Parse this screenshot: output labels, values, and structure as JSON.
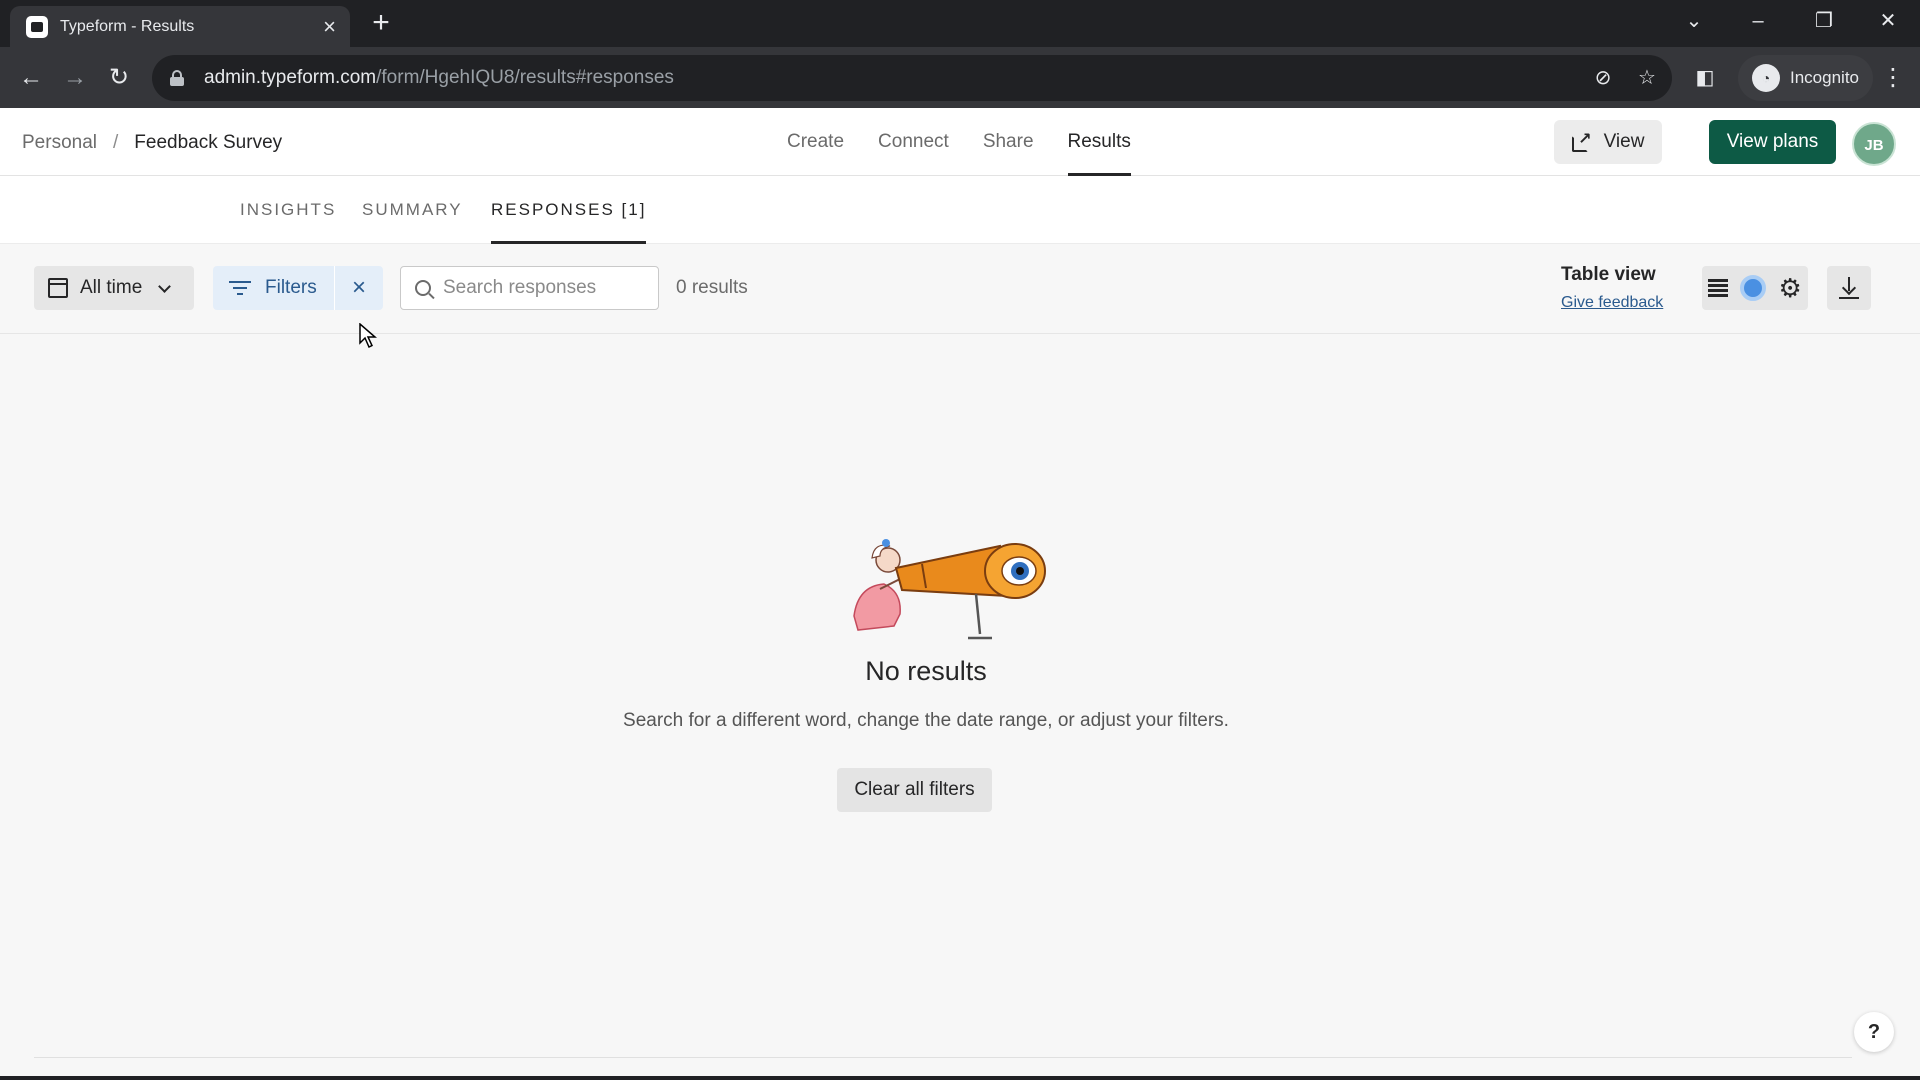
{
  "browser": {
    "tab_title": "Typeform - Results",
    "url_host": "admin.typeform.com",
    "url_path": "/form/HgehIQU8/results#responses",
    "profile_label": "Incognito"
  },
  "header": {
    "breadcrumb": [
      "Personal",
      "/",
      "Feedback Survey"
    ],
    "nav": [
      "Create",
      "Connect",
      "Share",
      "Results"
    ],
    "active_nav": "Results",
    "view_label": "View",
    "plans_label": "View plans",
    "avatar_initials": "JB"
  },
  "subtabs": {
    "items": [
      "INSIGHTS",
      "SUMMARY",
      "RESPONSES [1]"
    ],
    "active": "RESPONSES [1]"
  },
  "filterbar": {
    "date_label": "All time",
    "filters_label": "Filters",
    "clear_glyph": "×",
    "search_placeholder": "Search responses",
    "search_value": "",
    "results_count": "0 results",
    "table_view_label": "Table view",
    "feedback_link": "Give feedback"
  },
  "empty_state": {
    "title": "No results",
    "description": "Search for a different word, change the date range, or adjust your filters.",
    "button_label": "Clear all filters"
  },
  "help": {
    "label": "?"
  },
  "colors": {
    "brand_green": "#0d5a45",
    "filter_blue": "#2a5a8e",
    "toggle_blue": "#4a90e2"
  }
}
